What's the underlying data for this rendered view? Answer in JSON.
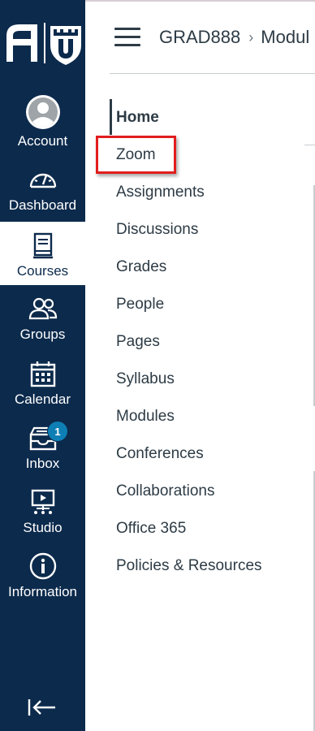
{
  "global_nav": {
    "logo": "university-logo",
    "items": [
      {
        "label": "Account",
        "icon": "avatar-icon"
      },
      {
        "label": "Dashboard",
        "icon": "dashboard-gauge-icon"
      },
      {
        "label": "Courses",
        "icon": "courses-book-icon",
        "active": true
      },
      {
        "label": "Groups",
        "icon": "groups-people-icon"
      },
      {
        "label": "Calendar",
        "icon": "calendar-icon"
      },
      {
        "label": "Inbox",
        "icon": "inbox-icon",
        "badge": "1"
      },
      {
        "label": "Studio",
        "icon": "studio-icon"
      },
      {
        "label": "Information",
        "icon": "info-icon"
      }
    ],
    "collapse_icon": "collapse-nav-icon"
  },
  "header": {
    "course": "GRAD888",
    "separator": "›",
    "page": "Modul"
  },
  "course_nav": {
    "items": [
      "Home",
      "Zoom",
      "Assignments",
      "Discussions",
      "Grades",
      "People",
      "Pages",
      "Syllabus",
      "Modules",
      "Conferences",
      "Collaborations",
      "Office 365",
      "Policies & Resources"
    ],
    "active": "Home",
    "highlighted": "Zoom"
  },
  "colors": {
    "nav_bg": "#0c2a4c",
    "text": "#2d3b45",
    "highlight": "#e21d1d",
    "badge": "#0e7fb5"
  }
}
